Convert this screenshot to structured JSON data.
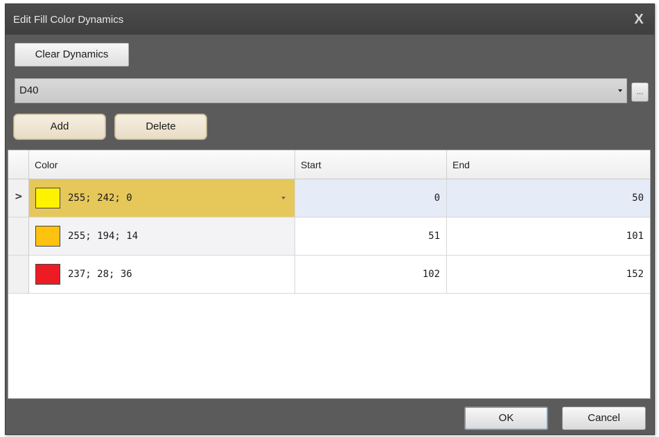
{
  "window": {
    "title": "Edit Fill Color Dynamics",
    "close_glyph": "X"
  },
  "toolbar": {
    "clear_label": "Clear Dynamics",
    "add_label": "Add",
    "delete_label": "Delete",
    "ellipsis_label": "..."
  },
  "source": {
    "selected_value": "D40"
  },
  "grid": {
    "columns": [
      "Color",
      "Start",
      "End"
    ],
    "current_row_indicator": ">",
    "rows": [
      {
        "color_hex": "#FFF200",
        "color_text": "255; 242; 0",
        "start": "0",
        "end": "50",
        "selected": true
      },
      {
        "color_hex": "#FFC20E",
        "color_text": "255; 194; 14",
        "start": "51",
        "end": "101",
        "selected": false
      },
      {
        "color_hex": "#ED1C24",
        "color_text": "237; 28; 36",
        "start": "102",
        "end": "152",
        "selected": false
      }
    ]
  },
  "footer": {
    "ok_label": "OK",
    "cancel_label": "Cancel"
  },
  "colors": {
    "selected_color_cell": "#E6C75A",
    "selected_row_cells": "#E6ECF7",
    "alternate_row": "#F3F3F6"
  }
}
